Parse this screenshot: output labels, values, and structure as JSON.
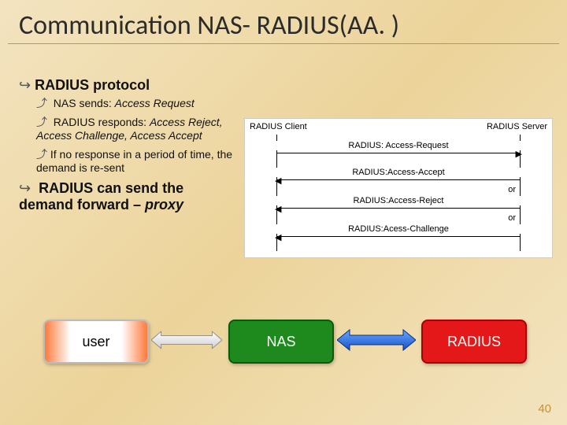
{
  "title": "Communication NAS- RADIUS(AA. )",
  "bullets": {
    "b1": "RADIUS protocol",
    "s1a": "NAS sends: ",
    "s1b": "Access Request",
    "s2a": "RADIUS responds: ",
    "s2b": "Access Reject, Access Challenge, Access Accept",
    "s3": "If no response in a period of time, the demand is re-sent",
    "b2a": "RADIUS can send the demand forward – ",
    "b2b": "proxy"
  },
  "seq": {
    "leftEnd": "RADIUS Client",
    "rightEnd": "RADIUS Server",
    "m1": "RADIUS: Access-Request",
    "m2": "RADIUS:Access-Accept",
    "m3": "RADIUS:Access-Reject",
    "m4": "RADIUS:Acess-Challenge",
    "or": "or"
  },
  "flow": {
    "user": "user",
    "nas": "NAS",
    "radius": "RADIUS"
  },
  "page": "40"
}
